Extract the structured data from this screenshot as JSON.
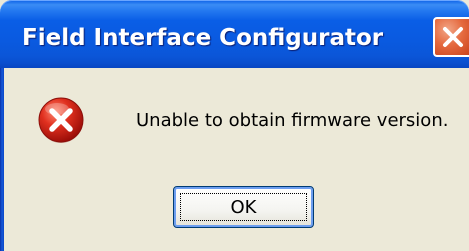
{
  "window": {
    "title": "Field Interface Configurator"
  },
  "dialog": {
    "icon": "error-icon",
    "message": "Unable to obtain firmware version.",
    "ok_label": "OK"
  },
  "colors": {
    "titlebar": "#0a5ee6",
    "dialog_background": "#ece9d8",
    "close_button": "#e56a3f",
    "error_icon": "#d9231d"
  }
}
